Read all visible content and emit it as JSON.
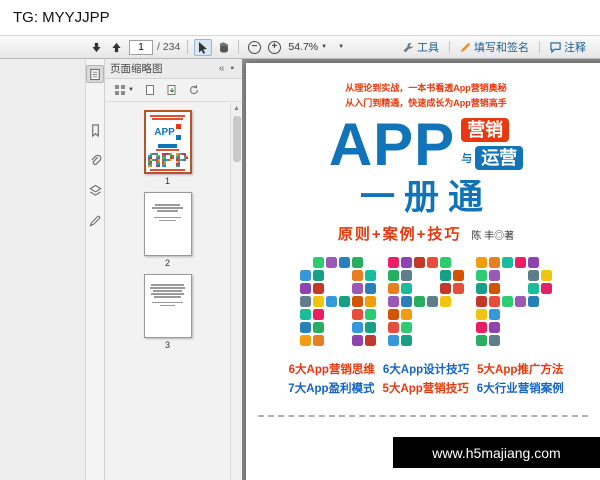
{
  "overlays": {
    "top_watermark": "TG: MYYJJPP",
    "bottom_watermark": "www.h5majiang.com"
  },
  "toolbar": {
    "page_current": "1",
    "page_total": "/ 234",
    "zoom_level": "54.7%",
    "tools_label": "工具",
    "fill_sign_label": "填写和签名",
    "comment_label": "注释"
  },
  "panel": {
    "title": "页面缩略图",
    "thumbnails": [
      {
        "page": "1"
      },
      {
        "page": "2"
      },
      {
        "page": "3"
      }
    ]
  },
  "cover": {
    "tagline1": "从理论到实战，一本书看透App营销奥秘",
    "tagline2": "从入门到精通，快速成长为App营销高手",
    "title": "APP",
    "badge_top": "营销",
    "badge_mid": "与",
    "badge_bottom": "运营",
    "subtitle": "一册通",
    "slogan": "原则+案例+技巧",
    "author": "陈 丰◎著",
    "mosaic_letters": [
      "A",
      "P",
      "P"
    ],
    "mosaic_maps": {
      "A": [
        "011110",
        "110011",
        "110011",
        "111111",
        "110011",
        "110011",
        "110011"
      ],
      "P": [
        "111110",
        "110011",
        "110011",
        "111110",
        "110000",
        "110000",
        "110000"
      ]
    },
    "mosaic_palette": [
      "#e74c3c",
      "#e67e22",
      "#f1c40f",
      "#2ecc71",
      "#1abc9c",
      "#3498db",
      "#9b59b6",
      "#e91e63",
      "#16a085",
      "#2980b9",
      "#8e44ad",
      "#d35400",
      "#27ae60",
      "#c0392b",
      "#f39c12",
      "#607d8b"
    ],
    "features_row1": [
      {
        "text": "6大App营销思维",
        "color": "#e8380d"
      },
      {
        "text": "6大App设计技巧",
        "color": "#1565c0"
      },
      {
        "text": "5大App推广方法",
        "color": "#e8380d"
      }
    ],
    "features_row2": [
      {
        "text": "7大App盈利模式",
        "color": "#1565c0"
      },
      {
        "text": "5大App营销技巧",
        "color": "#e8380d"
      },
      {
        "text": "6大行业营销案例",
        "color": "#1565c0"
      }
    ],
    "colors": {
      "title_blue": "#1173b8",
      "accent_red": "#e8380d"
    }
  }
}
